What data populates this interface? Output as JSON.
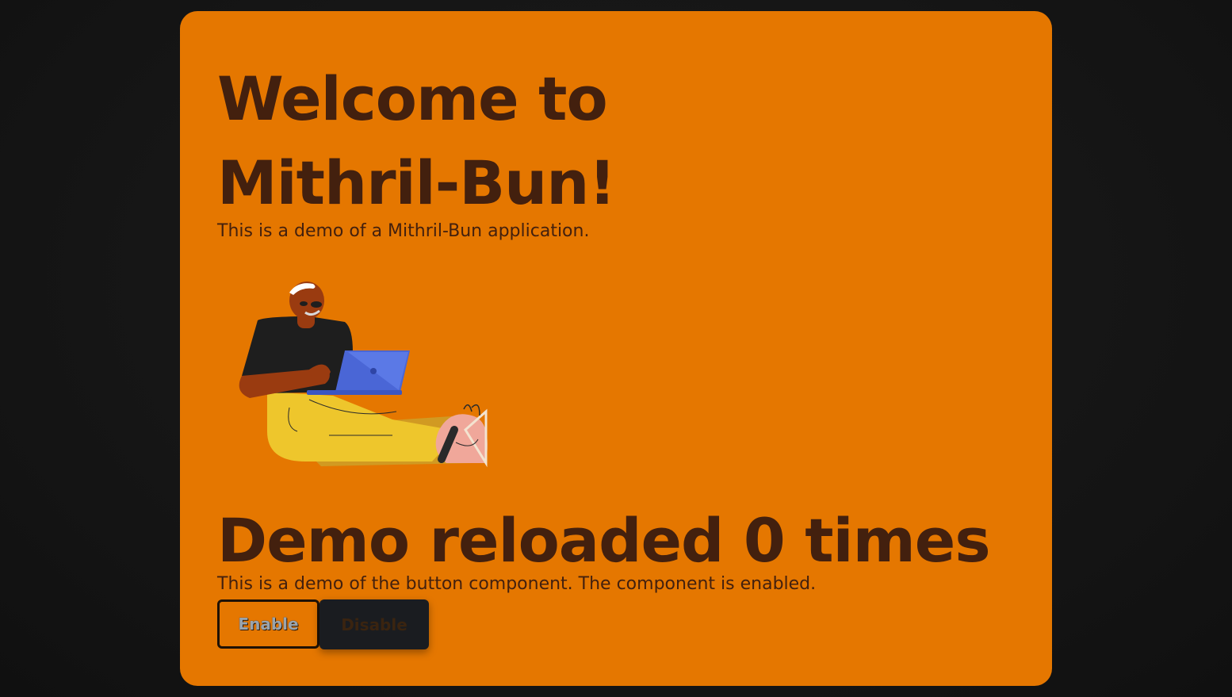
{
  "hero": {
    "title": "Welcome to Mithril-Bun!",
    "subtitle": "This is a demo of a Mithril-Bun application.",
    "illustration": "person-with-laptop-illustration"
  },
  "demo": {
    "counter_text": "Demo reloaded 0 times",
    "description": "This is a demo of the button component. The component is enabled.",
    "enable_label": "Enable",
    "disable_label": "Disable"
  },
  "colors": {
    "card_background": "#e57700",
    "text": "#43200e",
    "page_background": "#151515",
    "disable_button": "#1a1c20"
  }
}
